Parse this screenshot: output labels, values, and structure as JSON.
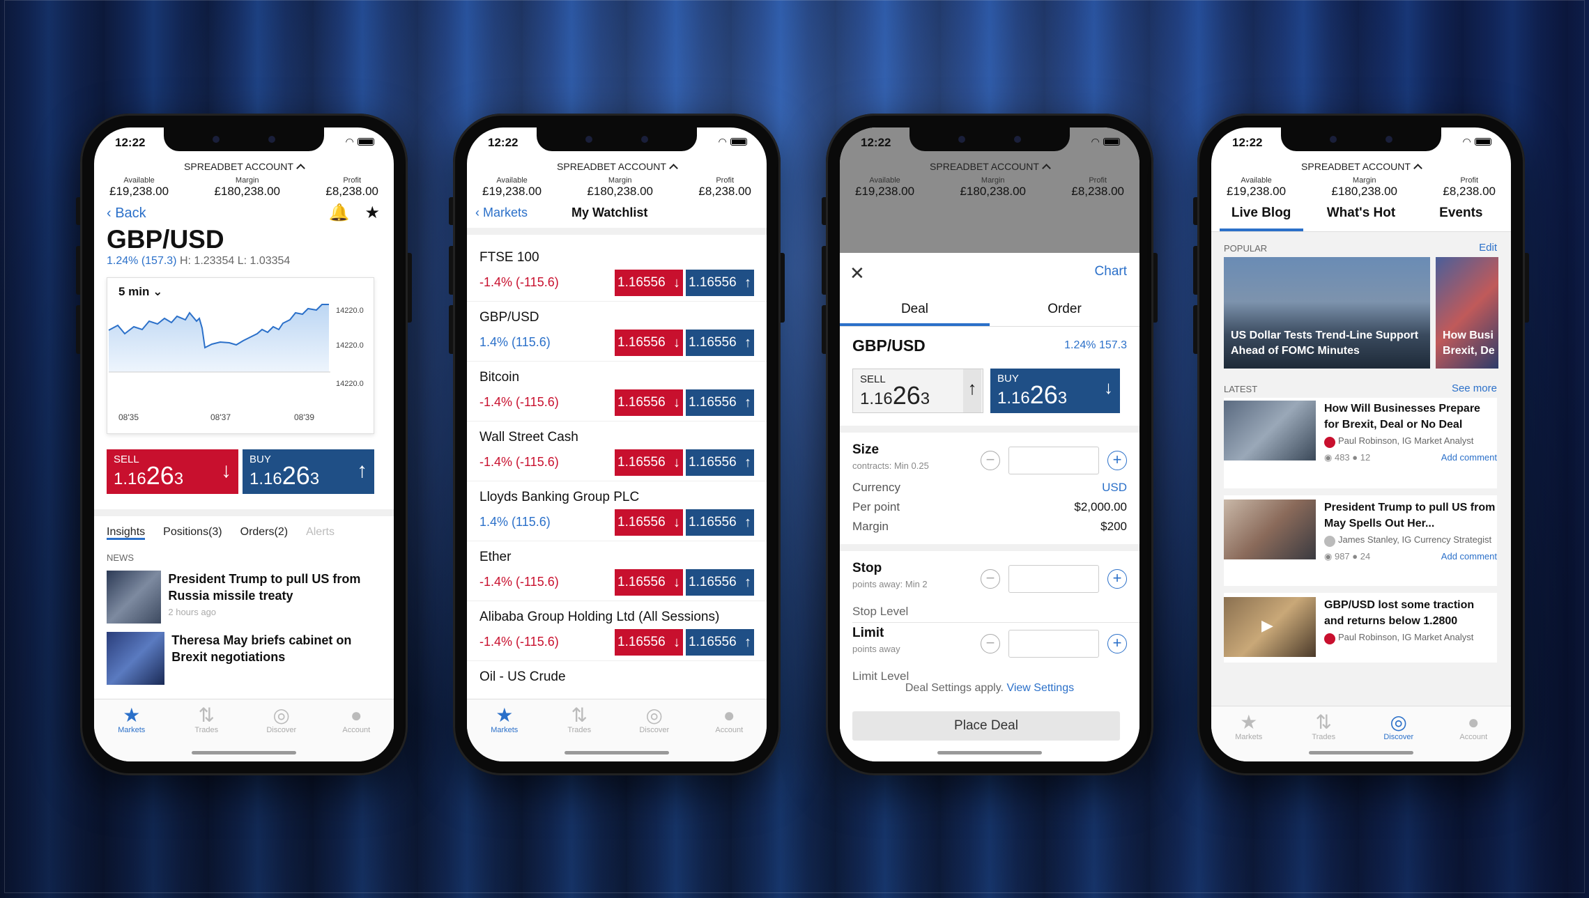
{
  "status": {
    "time": "12:22"
  },
  "account": {
    "title": "SPREADBET ACCOUNT",
    "available_label": "Available",
    "available": "£19,238.00",
    "margin_label": "Margin",
    "margin": "£180,238.00",
    "profit_label": "Profit",
    "profit": "£8,238.00"
  },
  "tabbar": {
    "markets": "Markets",
    "trades": "Trades",
    "discover": "Discover",
    "account": "Account"
  },
  "p1": {
    "back": "Back",
    "title": "GBP/USD",
    "change": "1.24% (157.3)",
    "hl": "H: 1.23354  L: 1.03354",
    "chart": {
      "timeframe": "5 min",
      "yticks": [
        "14220.0",
        "14220.0",
        "14220.0"
      ],
      "xticks": [
        "08'35",
        "08'37",
        "08'39"
      ]
    },
    "sell_label": "SELL",
    "sell_price_a": "1.16",
    "sell_price_b": "26",
    "sell_price_c": "3",
    "buy_label": "BUY",
    "buy_price_a": "1.16",
    "buy_price_b": "26",
    "buy_price_c": "3",
    "tabs": [
      "Insights",
      "Positions(3)",
      "Orders(2)",
      "Alerts"
    ],
    "news_heading": "NEWS",
    "news": [
      {
        "title": "President Trump to pull US from Russia missile treaty",
        "meta": "2 hours ago"
      },
      {
        "title": "Theresa May briefs cabinet on Brexit negotiations",
        "meta": ""
      }
    ]
  },
  "p2": {
    "back": "Markets",
    "title": "My Watchlist",
    "rows": [
      {
        "name": "FTSE 100",
        "change": "-1.4% (-115.6)",
        "sell": "1.16556",
        "buy": "1.16556"
      },
      {
        "name": "GBP/USD",
        "change": "1.4%  (115.6)",
        "sell": "1.16556",
        "buy": "1.16556"
      },
      {
        "name": "Bitcoin",
        "change": "-1.4% (-115.6)",
        "sell": "1.16556",
        "buy": "1.16556"
      },
      {
        "name": "Wall Street Cash",
        "change": "-1.4% (-115.6)",
        "sell": "1.16556",
        "buy": "1.16556"
      },
      {
        "name": "Lloyds Banking Group PLC",
        "change": "1.4%  (115.6)",
        "sell": "1.16556",
        "buy": "1.16556"
      },
      {
        "name": "Ether",
        "change": "-1.4% (-115.6)",
        "sell": "1.16556",
        "buy": "1.16556"
      },
      {
        "name": "Alibaba Group Holding Ltd (All Sessions)",
        "change": "-1.4% (-115.6)",
        "sell": "1.16556",
        "buy": "1.16556"
      },
      {
        "name": "Oil - US Crude",
        "change": "",
        "sell": "",
        "buy": ""
      }
    ]
  },
  "p3": {
    "chart": "Chart",
    "seg_deal": "Deal",
    "seg_order": "Order",
    "market": "GBP/USD",
    "change": "1.24% 157.3",
    "sell_label": "SELL",
    "buy_label": "BUY",
    "price_a": "1.16",
    "price_b": "26",
    "price_c": "3",
    "size": "Size",
    "size_sub": "contracts: Min 0.25",
    "currency_label": "Currency",
    "currency": "USD",
    "perpoint_label": "Per point",
    "perpoint": "$2,000.00",
    "margin_label": "Margin",
    "margin": "$200",
    "stop": "Stop",
    "stop_sub": "points away: Min 2",
    "stop_level": "Stop Level",
    "limit": "Limit",
    "limit_sub": "points away",
    "limit_level": "Limit Level",
    "settings_text": "Deal Settings apply.",
    "settings_link": "View Settings",
    "place": "Place Deal"
  },
  "p4": {
    "tabs": [
      "Live Blog",
      "What's Hot",
      "Events"
    ],
    "popular": "POPULAR",
    "edit": "Edit",
    "cards": [
      {
        "title": "US Dollar Tests Trend-Line Support Ahead of FOMC Minutes"
      },
      {
        "title": "How Busi Brexit, De"
      }
    ],
    "latest": "LATEST",
    "see_more": "See more",
    "items": [
      {
        "title": "How Will Businesses Prepare for Brexit, Deal or No Deal",
        "author": "Paul Robinson, IG Market Analyst",
        "views": "483",
        "comments": "12",
        "add": "Add comment"
      },
      {
        "title": "President Trump to pull US from May Spells Out Her...",
        "author": "James Stanley, IG Currency Strategist",
        "views": "987",
        "comments": "24",
        "add": "Add comment"
      },
      {
        "title": "GBP/USD lost some traction and returns below 1.2800",
        "author": "Paul Robinson, IG Market Analyst",
        "views": "",
        "comments": "",
        "add": ""
      }
    ]
  }
}
